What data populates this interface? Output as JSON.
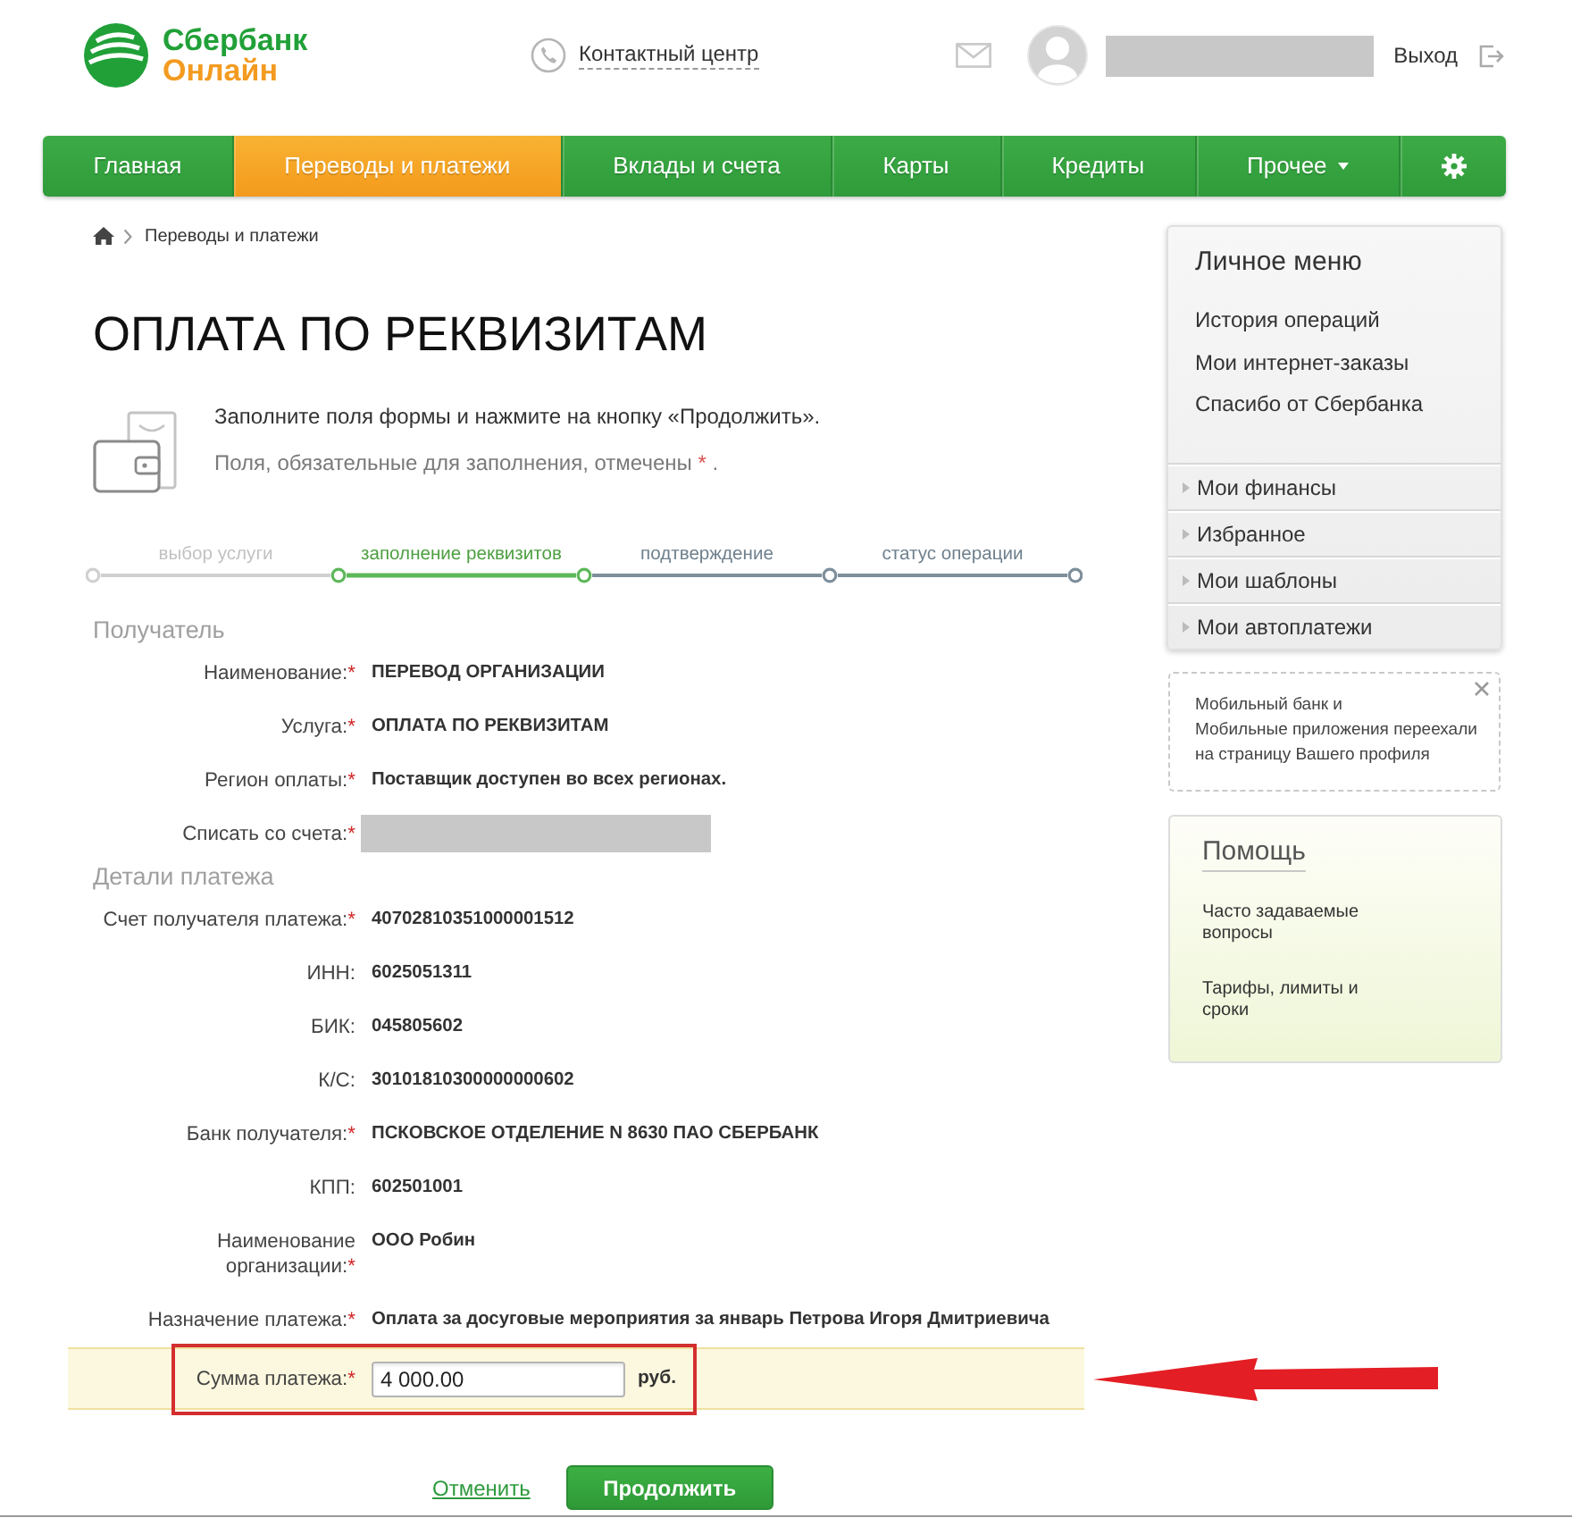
{
  "header": {
    "logo_top": "Сбербанк",
    "logo_bottom": "Онлайн",
    "contact_link": "Контактный центр",
    "logout_link": "Выход"
  },
  "nav": [
    {
      "label": "Главная",
      "kind": "link",
      "selected": false
    },
    {
      "label": "Переводы и платежи",
      "kind": "link",
      "selected": true
    },
    {
      "label": "Вклады и счета",
      "kind": "link",
      "selected": false
    },
    {
      "label": "Карты",
      "kind": "link",
      "selected": false
    },
    {
      "label": "Кредиты",
      "kind": "link",
      "selected": false
    },
    {
      "label": "Прочее",
      "kind": "dropdown",
      "selected": false
    },
    {
      "kind": "settings",
      "selected": false
    }
  ],
  "breadcrumb": {
    "link": "Переводы и платежи"
  },
  "page_title": "ОПЛАТА ПО РЕКВИЗИТАМ",
  "intro": {
    "instruction": "Заполните поля формы и нажмите на кнопку «Продолжить».",
    "required_note": {
      "text": "Поля, обязательные для заполнения, отмечены",
      "mark": "*",
      "end": "."
    }
  },
  "steps": [
    {
      "label": "выбор услуги",
      "completed": true,
      "current": false
    },
    {
      "label": "заполнение реквизитов",
      "completed": false,
      "current": true
    },
    {
      "label": "подтверждение",
      "completed": false,
      "current": false
    },
    {
      "label": "статус операции",
      "completed": false,
      "current": false
    }
  ],
  "form": {
    "sections": [
      {
        "title": "Получатель",
        "rows": [
          {
            "label": "Наименование:",
            "mark": "*",
            "kind": "text",
            "value": "ПЕРЕВОД ОРГАНИЗАЦИИ"
          },
          {
            "label": "Услуга:",
            "mark": "*",
            "kind": "text",
            "value": "ОПЛАТА ПО РЕКВИЗИТАМ"
          },
          {
            "label": "Регион оплаты:",
            "mark": "*",
            "kind": "text",
            "value": "Поставщик доступен во всех регионах."
          },
          {
            "label": "Списать со счета:",
            "mark": "*",
            "kind": "masked"
          }
        ]
      },
      {
        "title": "Детали платежа",
        "rows": [
          {
            "label": "Счет получателя платежа:",
            "mark": "*",
            "kind": "text",
            "value": "40702810351000001512"
          },
          {
            "label": "ИНН:",
            "kind": "text",
            "value": "6025051311"
          },
          {
            "label": "БИК:",
            "kind": "text",
            "value": "045805602"
          },
          {
            "label": "К/С:",
            "kind": "text",
            "value": "30101810300000000602"
          },
          {
            "label": "Банк получателя:",
            "mark": "*",
            "kind": "text",
            "value": "ПСКОВСКОЕ ОТДЕЛЕНИЕ N 8630 ПАО СБЕРБАНК"
          },
          {
            "label": "КПП:",
            "kind": "text",
            "value": "602501001"
          },
          {
            "label": "Наименование организации:",
            "mark": "*",
            "kind": "text",
            "value": "ООО Робин"
          },
          {
            "label": "Назначение платежа:",
            "mark": "*",
            "kind": "text",
            "value": "Оплата за досуговые мероприятия за январь Петрова Игоря Дмитриевича"
          }
        ]
      }
    ],
    "amount": {
      "label": "Сумма платежа:",
      "mark": "*",
      "value": "4 000.00",
      "unit": "руб.",
      "highlighted": true
    }
  },
  "actions": {
    "cancel": "Отменить",
    "submit": "Продолжить"
  },
  "personal_menu": {
    "title": "Личное меню",
    "links": [
      "История операций",
      "Мои интернет-заказы",
      "Спасибо от Сбербанка"
    ],
    "sections": [
      {
        "label": "Мои финансы",
        "expanded": false
      },
      {
        "label": "Избранное",
        "expanded": false
      },
      {
        "label": "Мои шаблоны",
        "expanded": false
      },
      {
        "label": "Мои автоплатежи",
        "expanded": false
      }
    ]
  },
  "notice": {
    "parts": [
      {
        "kind": "link",
        "text": "Мобильный банк"
      },
      {
        "kind": "text",
        "text": "и"
      },
      {
        "kind": "link",
        "text": "Мобильные приложения"
      },
      {
        "kind": "text",
        "text": "переехали на страницу Вашего профиля"
      }
    ]
  },
  "help": {
    "title": "Помощь",
    "links": [
      "Часто задаваемые вопросы",
      "Тарифы, лимиты и сроки"
    ]
  }
}
